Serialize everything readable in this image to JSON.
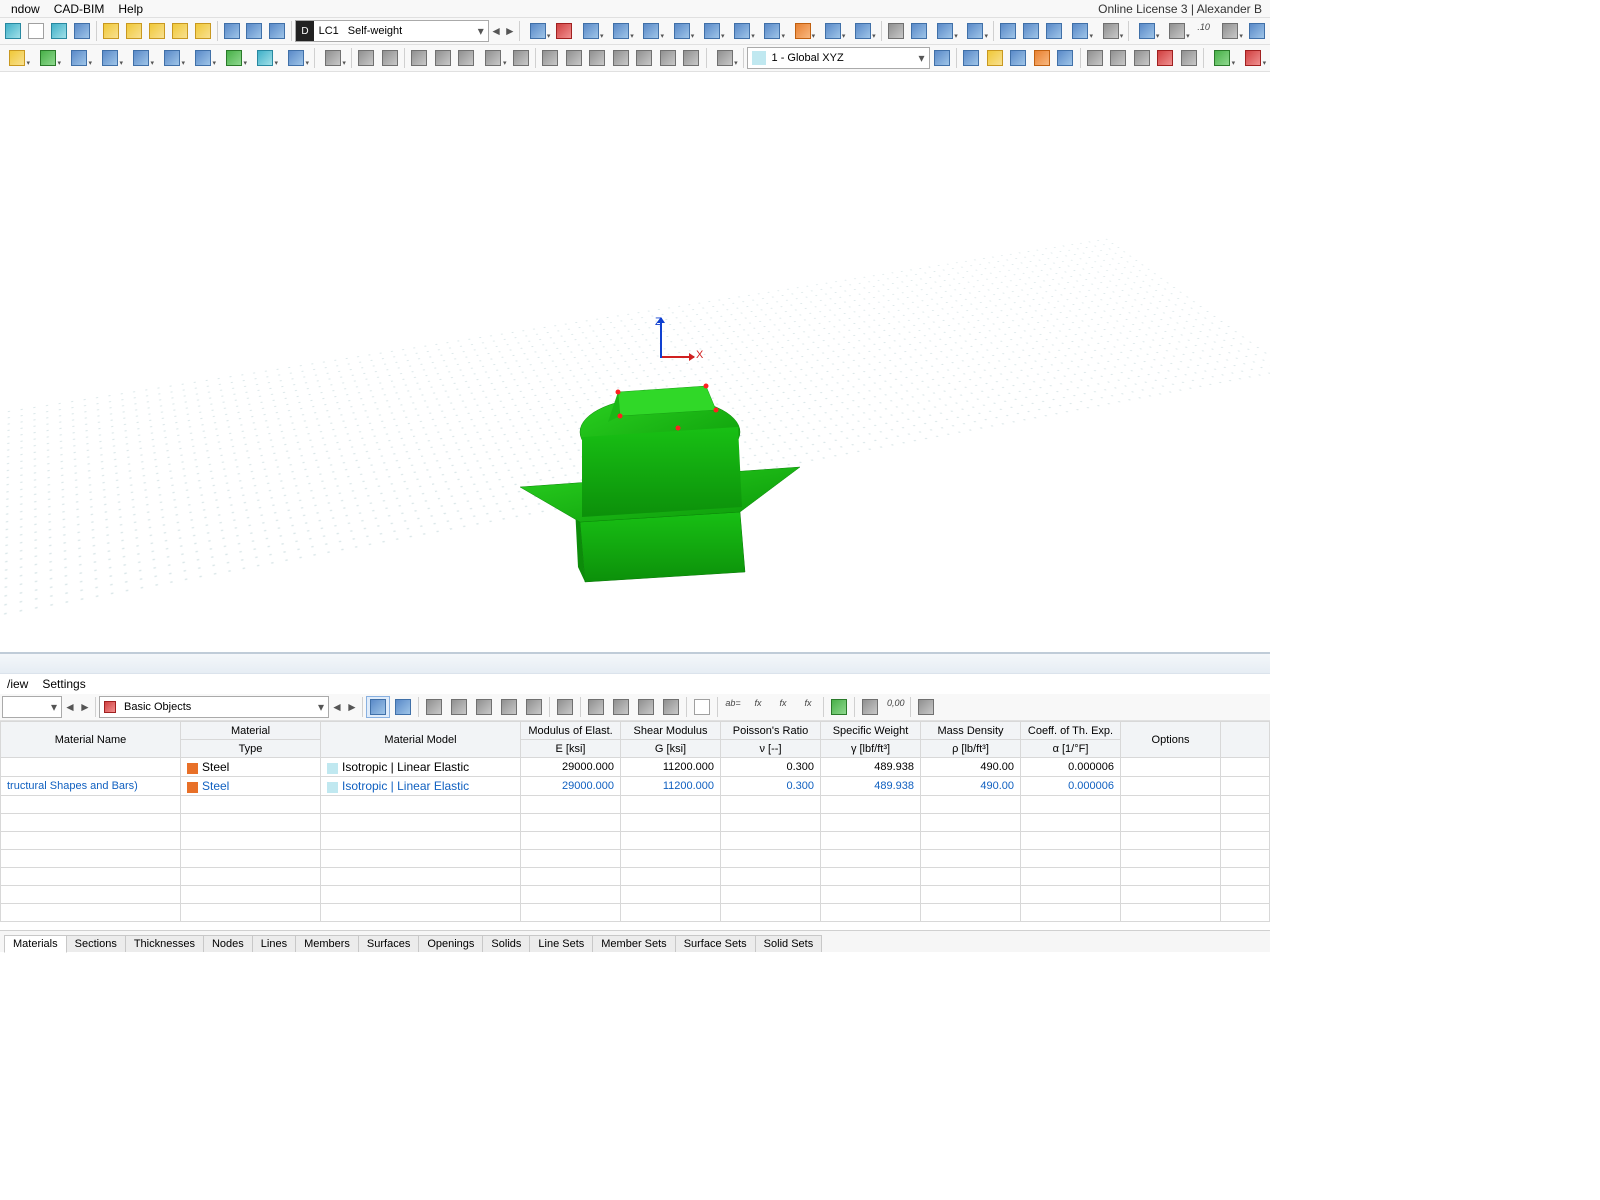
{
  "menu": {
    "window": "ndow",
    "cadbim": "CAD-BIM",
    "help": "Help"
  },
  "license": "Online License 3 | Alexander B",
  "loadcase": {
    "d": "D",
    "lc": "LC1",
    "name": "Self-weight"
  },
  "coordsys": "1 - Global XYZ",
  "axes": {
    "z": "Z",
    "x": "X"
  },
  "precision": ".10",
  "fx": {
    "ab": "ab=",
    "f1": "fx",
    "f2": "fx",
    "f3": "fx"
  },
  "zero": "0,00",
  "panel": {
    "menu": {
      "view": "/iew",
      "settings": "Settings"
    },
    "basic_objects": "Basic Objects",
    "headers": {
      "name1": "Material Name",
      "type1": "Material",
      "type2": "Type",
      "model": "Material Model",
      "e1": "Modulus of Elast.",
      "e2": "E [ksi]",
      "g1": "Shear Modulus",
      "g2": "G [ksi]",
      "nu1": "Poisson's Ratio",
      "nu2": "ν [--]",
      "gamma1": "Specific Weight",
      "gamma2": "γ [lbf/ft³]",
      "rho1": "Mass Density",
      "rho2": "ρ [lb/ft³]",
      "alpha1": "Coeff. of Th. Exp.",
      "alpha2": "α [1/°F]",
      "opt": "Options"
    },
    "rows": [
      {
        "name": "",
        "type": "Steel",
        "model": "Isotropic | Linear Elastic",
        "e": "29000.000",
        "g": "11200.000",
        "nu": "0.300",
        "gamma": "489.938",
        "rho": "490.00",
        "alpha": "0.000006"
      },
      {
        "name": "tructural Shapes and Bars)",
        "type": "Steel",
        "model": "Isotropic | Linear Elastic",
        "e": "29000.000",
        "g": "11200.000",
        "nu": "0.300",
        "gamma": "489.938",
        "rho": "490.00",
        "alpha": "0.000006"
      }
    ]
  },
  "tabs": [
    "Materials",
    "Sections",
    "Thicknesses",
    "Nodes",
    "Lines",
    "Members",
    "Surfaces",
    "Openings",
    "Solids",
    "Line Sets",
    "Member Sets",
    "Surface Sets",
    "Solid Sets"
  ]
}
